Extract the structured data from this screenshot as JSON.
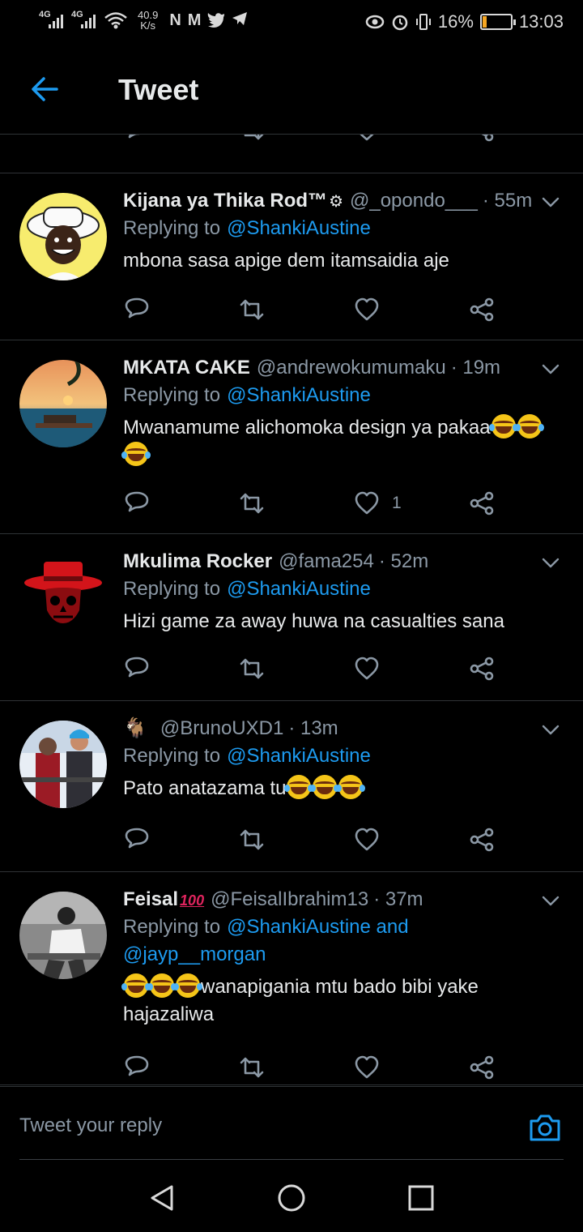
{
  "status": {
    "signal1": "4G",
    "signal2": "4G",
    "speed_value": "40.9",
    "speed_unit": "K/s",
    "notif_icons": [
      "N",
      "M",
      "twitter-bird",
      "telegram"
    ],
    "battery": "16%",
    "battery_level": 0.16,
    "time": "13:03"
  },
  "header": {
    "title": "Tweet"
  },
  "partial": {
    "like_count": "1"
  },
  "tweets": [
    {
      "name": "Kijana ya Thika Rod™",
      "handle": "@_opondo___",
      "time": "· 55m",
      "reply_prefix": "Replying to",
      "mentions": "@ShankiAustine",
      "mentions2": "",
      "text": "mbona sasa apige dem itamsaidia aje",
      "text2": "",
      "like_count": ""
    },
    {
      "name": "MKATA CAKE",
      "handle": "@andrewokumumaku",
      "time": "· 19m",
      "reply_prefix": "Replying to",
      "mentions": "@ShankiAustine",
      "mentions2": "",
      "text": "Mwanamume alichomoka design ya pakaa",
      "text2": "",
      "like_count": "1"
    },
    {
      "name": "Mkulima Rocker",
      "handle": "@fama254",
      "time": "· 52m",
      "reply_prefix": "Replying to",
      "mentions": "@ShankiAustine",
      "mentions2": "",
      "text": "Hizi game za away huwa na casualties sana",
      "text2": "",
      "like_count": ""
    },
    {
      "name": "",
      "handle": "@BrunoUXD1",
      "time": "· 13m",
      "reply_prefix": "Replying to",
      "mentions": "@ShankiAustine",
      "mentions2": "",
      "text": "Pato anatazama tu",
      "text2": "",
      "like_count": ""
    },
    {
      "name": "Feisal",
      "handle": "@FeisalIbrahim13",
      "time": "· 37m",
      "reply_prefix": "Replying to",
      "mentions": "@ShankiAustine and",
      "mentions2": "@jayp__morgan",
      "text": "wanapigania mtu bado bibi yake",
      "text2": "hajazaliwa",
      "like_count": ""
    }
  ],
  "composer": {
    "placeholder": "Tweet your reply"
  },
  "colors": {
    "accent": "#1d9bf0",
    "bg": "#000000",
    "muted": "#8b98a5",
    "divider": "#2f3336"
  }
}
